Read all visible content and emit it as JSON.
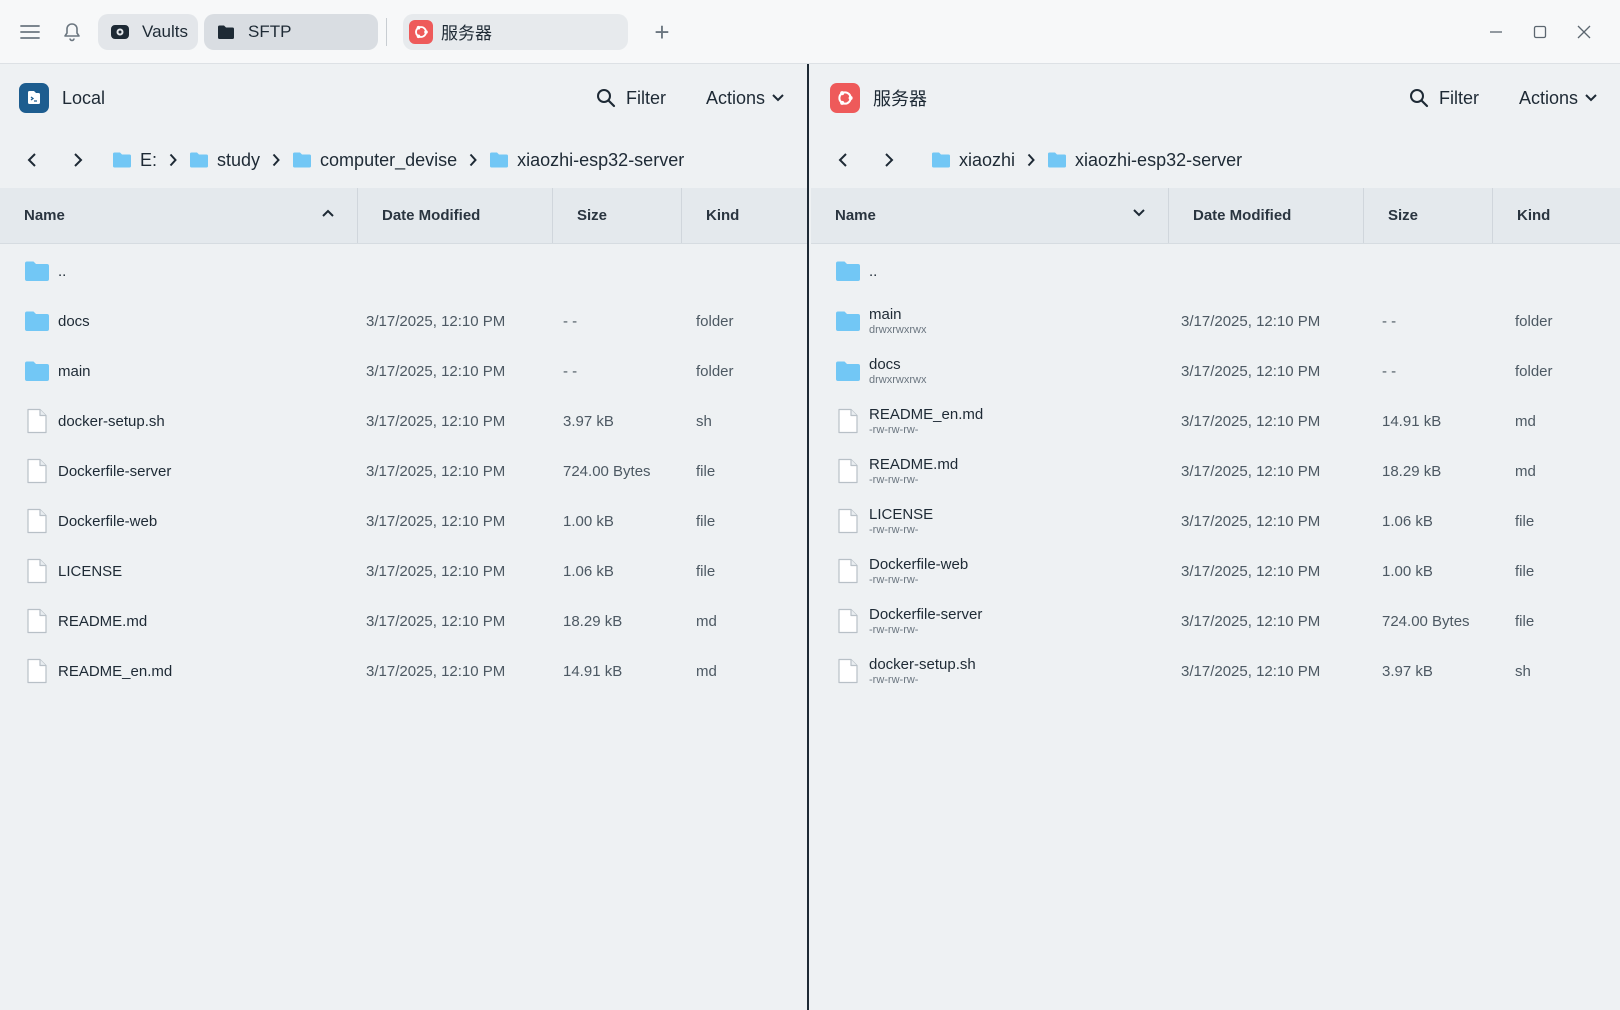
{
  "titlebar": {
    "tabs": [
      {
        "label": "Vaults",
        "icon": "vault-icon"
      },
      {
        "label": "SFTP",
        "icon": "folder-icon"
      },
      {
        "label": "服务器",
        "icon": "ubuntu-icon"
      }
    ]
  },
  "left": {
    "title": "Local",
    "filter_label": "Filter",
    "actions_label": "Actions",
    "breadcrumb": [
      "E:",
      "study",
      "computer_devise",
      "xiaozhi-esp32-server"
    ],
    "columns": {
      "name": "Name",
      "date": "Date Modified",
      "size": "Size",
      "kind": "Kind"
    },
    "parent": "..",
    "rows": [
      {
        "name": "docs",
        "date": "3/17/2025, 12:10 PM",
        "size": "- -",
        "kind": "folder"
      },
      {
        "name": "main",
        "date": "3/17/2025, 12:10 PM",
        "size": "- -",
        "kind": "folder"
      },
      {
        "name": "docker-setup.sh",
        "date": "3/17/2025, 12:10 PM",
        "size": "3.97 kB",
        "kind": "sh"
      },
      {
        "name": "Dockerfile-server",
        "date": "3/17/2025, 12:10 PM",
        "size": "724.00 Bytes",
        "kind": "file"
      },
      {
        "name": "Dockerfile-web",
        "date": "3/17/2025, 12:10 PM",
        "size": "1.00 kB",
        "kind": "file"
      },
      {
        "name": "LICENSE",
        "date": "3/17/2025, 12:10 PM",
        "size": "1.06 kB",
        "kind": "file"
      },
      {
        "name": "README.md",
        "date": "3/17/2025, 12:10 PM",
        "size": "18.29 kB",
        "kind": "md"
      },
      {
        "name": "README_en.md",
        "date": "3/17/2025, 12:10 PM",
        "size": "14.91 kB",
        "kind": "md"
      }
    ]
  },
  "right": {
    "title": "服务器",
    "filter_label": "Filter",
    "actions_label": "Actions",
    "breadcrumb": [
      "xiaozhi",
      "xiaozhi-esp32-server"
    ],
    "columns": {
      "name": "Name",
      "date": "Date Modified",
      "size": "Size",
      "kind": "Kind"
    },
    "parent": "..",
    "rows": [
      {
        "name": "main",
        "perm": "drwxrwxrwx",
        "date": "3/17/2025, 12:10 PM",
        "size": "- -",
        "kind": "folder"
      },
      {
        "name": "docs",
        "perm": "drwxrwxrwx",
        "date": "3/17/2025, 12:10 PM",
        "size": "- -",
        "kind": "folder"
      },
      {
        "name": "README_en.md",
        "perm": "-rw-rw-rw-",
        "date": "3/17/2025, 12:10 PM",
        "size": "14.91 kB",
        "kind": "md"
      },
      {
        "name": "README.md",
        "perm": "-rw-rw-rw-",
        "date": "3/17/2025, 12:10 PM",
        "size": "18.29 kB",
        "kind": "md"
      },
      {
        "name": "LICENSE",
        "perm": "-rw-rw-rw-",
        "date": "3/17/2025, 12:10 PM",
        "size": "1.06 kB",
        "kind": "file"
      },
      {
        "name": "Dockerfile-web",
        "perm": "-rw-rw-rw-",
        "date": "3/17/2025, 12:10 PM",
        "size": "1.00 kB",
        "kind": "file"
      },
      {
        "name": "Dockerfile-server",
        "perm": "-rw-rw-rw-",
        "date": "3/17/2025, 12:10 PM",
        "size": "724.00 Bytes",
        "kind": "file"
      },
      {
        "name": "docker-setup.sh",
        "perm": "-rw-rw-rw-",
        "date": "3/17/2025, 12:10 PM",
        "size": "3.97 kB",
        "kind": "sh"
      }
    ]
  },
  "colors": {
    "accent_folder": "#72c7f5",
    "server_badge": "#ee5a5a",
    "local_badge": "#1d5d8f"
  }
}
